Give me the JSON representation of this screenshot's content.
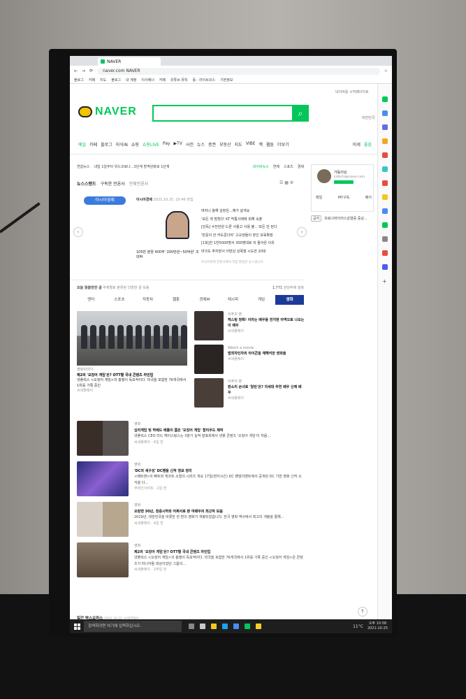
{
  "browser": {
    "tab_title": "NAVER",
    "address": "naver.com  NAVER",
    "bookmarks": [
      "블로그",
      "카페",
      "지도",
      "블로그",
      "내 계정",
      "이사배너",
      "카페",
      "유튜브 뮤직",
      "동 · 라이브코스",
      "기본정보"
    ]
  },
  "naver": {
    "logo_text": "NAVER",
    "search_placeholder": "",
    "search_button_icon": "search-icon",
    "top_link_1": "네이버를 시작페이지로",
    "top_link_2": "대한민국",
    "services": [
      "메일",
      "카페",
      "블로그",
      "지식iN",
      "쇼핑",
      "쇼핑LIVE",
      "Pay",
      "▶TV",
      "사전",
      "뉴스",
      "증권",
      "부동산",
      "지도",
      "VIBE",
      "책",
      "웹툰",
      "더보기"
    ],
    "weather": "미세",
    "weather_status": "좋음",
    "news_headline_line": [
      "연합뉴스",
      "내일 1일부터 위드코로나...3단계 방역완화로 1단계"
    ],
    "news_headline_right": [
      "네이버뉴스",
      "연예",
      "스포츠",
      "경제"
    ],
    "newsstand_label": "뉴스스탠드",
    "newsstand_sub": "구독한 언론사",
    "newsstand_all": "전체언론사",
    "press_badge": "아시아경제",
    "press_name": "아시아경제",
    "press_date": "2021.10.25. 20:46 편집",
    "thumb_caption": "105만 분양 400주 '200만원~50억원' 조대박",
    "headlines": [
      "여러니 올해 김장은...채가 살개요",
      "'모든 게 멈췄다' KT 먹통사태에 피해 속출",
      "[단독] 수천만원 드론 사들고 사용 불...'모든 안 된다",
      "'반응이 안 커도준다야' 고교생들이 장인 보육확장",
      "[1회]진 1천5000명서 300명대로 뒤 들어온 이유",
      "마크도 주차장서 어떤남 성폭행 시도한 20대"
    ],
    "subscribe_info": "아시아경제 언론사에서 직접 편집한 뉴스입니다.",
    "profile": {
      "name": "가동이님",
      "email": "kidkchl@naver.com",
      "menu": [
        "메일",
        "MY구독",
        "페이"
      ]
    },
    "notice_tag": "공지",
    "notice_text": "프로나바이러스감염증 증상...",
    "today_label": "오늘 읽을만한 글",
    "today_sub": "주제별로 분류된 다양한 글 모음",
    "today_count": "1,771",
    "today_setting": "관심주제 설정",
    "categories": [
      "엔터",
      "스포츠",
      "자동차",
      "웹툰",
      "경제M",
      "레시피",
      "게임",
      "영화"
    ],
    "big_caption_tag": "영화이야기",
    "big_caption_title": "제2의 '오징어 게임'은? OTT별 국내 콘텐츠 라인업",
    "big_caption_body": "넷플릭스 <오징어 게임>의 흥행이 독보적이다. 미국을 포함한 76개국에서 1위를 기록 중인",
    "big_caption_src": "씨네플레이",
    "small_items": [
      {
        "tag": "이주의 영",
        "title": "캐스팅 정확! 이라는 배우들 전지현 아역으로 나오는 이 배우",
        "src": "씨네플레이"
      },
      {
        "tag": "Watch a movie",
        "title": "범죄자인자의 아이콘을 재해석한 영화들",
        "src": "씨네플레이"
      },
      {
        "tag": "이주의 영",
        "title": "판소리 손녀로 '알린'은? 차세대 주연 배우 신예 배우",
        "src": "씨네플레이"
      }
    ],
    "list_items": [
      {
        "tag": "영화",
        "title": "심리게임 및 하베드 배틀이 쫌은 '오징어 게임' 할리우드 제작",
        "body": "넷플릭스 CEO 리드 헤이스팅스는 3분기 실적 발표회에서 넷플 콘텐츠 '오징어 게임'이 처음...",
        "src": "씨네플레이 · 4일 전"
      },
      {
        "tag": "영화",
        "title": "'DC의 새구성' DC팬들 신작 정보 정리",
        "body": "<배트맨>의 빠트와 게코트 소형의 시리즈 개요 17일(현지시간) DC 팬덤이벤트에서 공개된 DC 기반 영화 신작 소식을 다...",
        "src": "무비인사이트 · 1일 전"
      },
      {
        "tag": "영화",
        "title": "오랑캔 30년, 정중시하와 어쩌서로 본 여배우의 최근작 모음",
        "body": "2019년, 대한민국을 비롯한 한 편의 영화가 개봉되었습니다. 한국 영화 역사에서 최고의 개봉을 통해...",
        "src": "씨네플레이 · 4일 전"
      },
      {
        "tag": "영화",
        "title": "제2의 '오징어 게임'은? OTT별 국내 콘텐츠 라인업",
        "body": "넷플릭스 <오징어 게임>의 흥행이 독보적이다. 미국을 포함한 76개국에서 1위를 기록 중인 <오징어 게임>은 콘텐츠가 마니아들 대상이었던 그룹의...",
        "src": "씨네플레이 · 1주일 전"
      }
    ],
    "boxoffice_label": "일간 박스오피스",
    "boxoffice_date": "2021.10.22. 누적관객수"
  },
  "taskbar": {
    "search_placeholder": "검색하려면 여기에 입력하십시오.",
    "weather": "11°C",
    "time": "오후 10:58",
    "date": "2021-10-25"
  },
  "colors": {
    "naver_green": "#03c75a",
    "category_active": "#1c3b99",
    "press_badge": "#3b7bde"
  }
}
